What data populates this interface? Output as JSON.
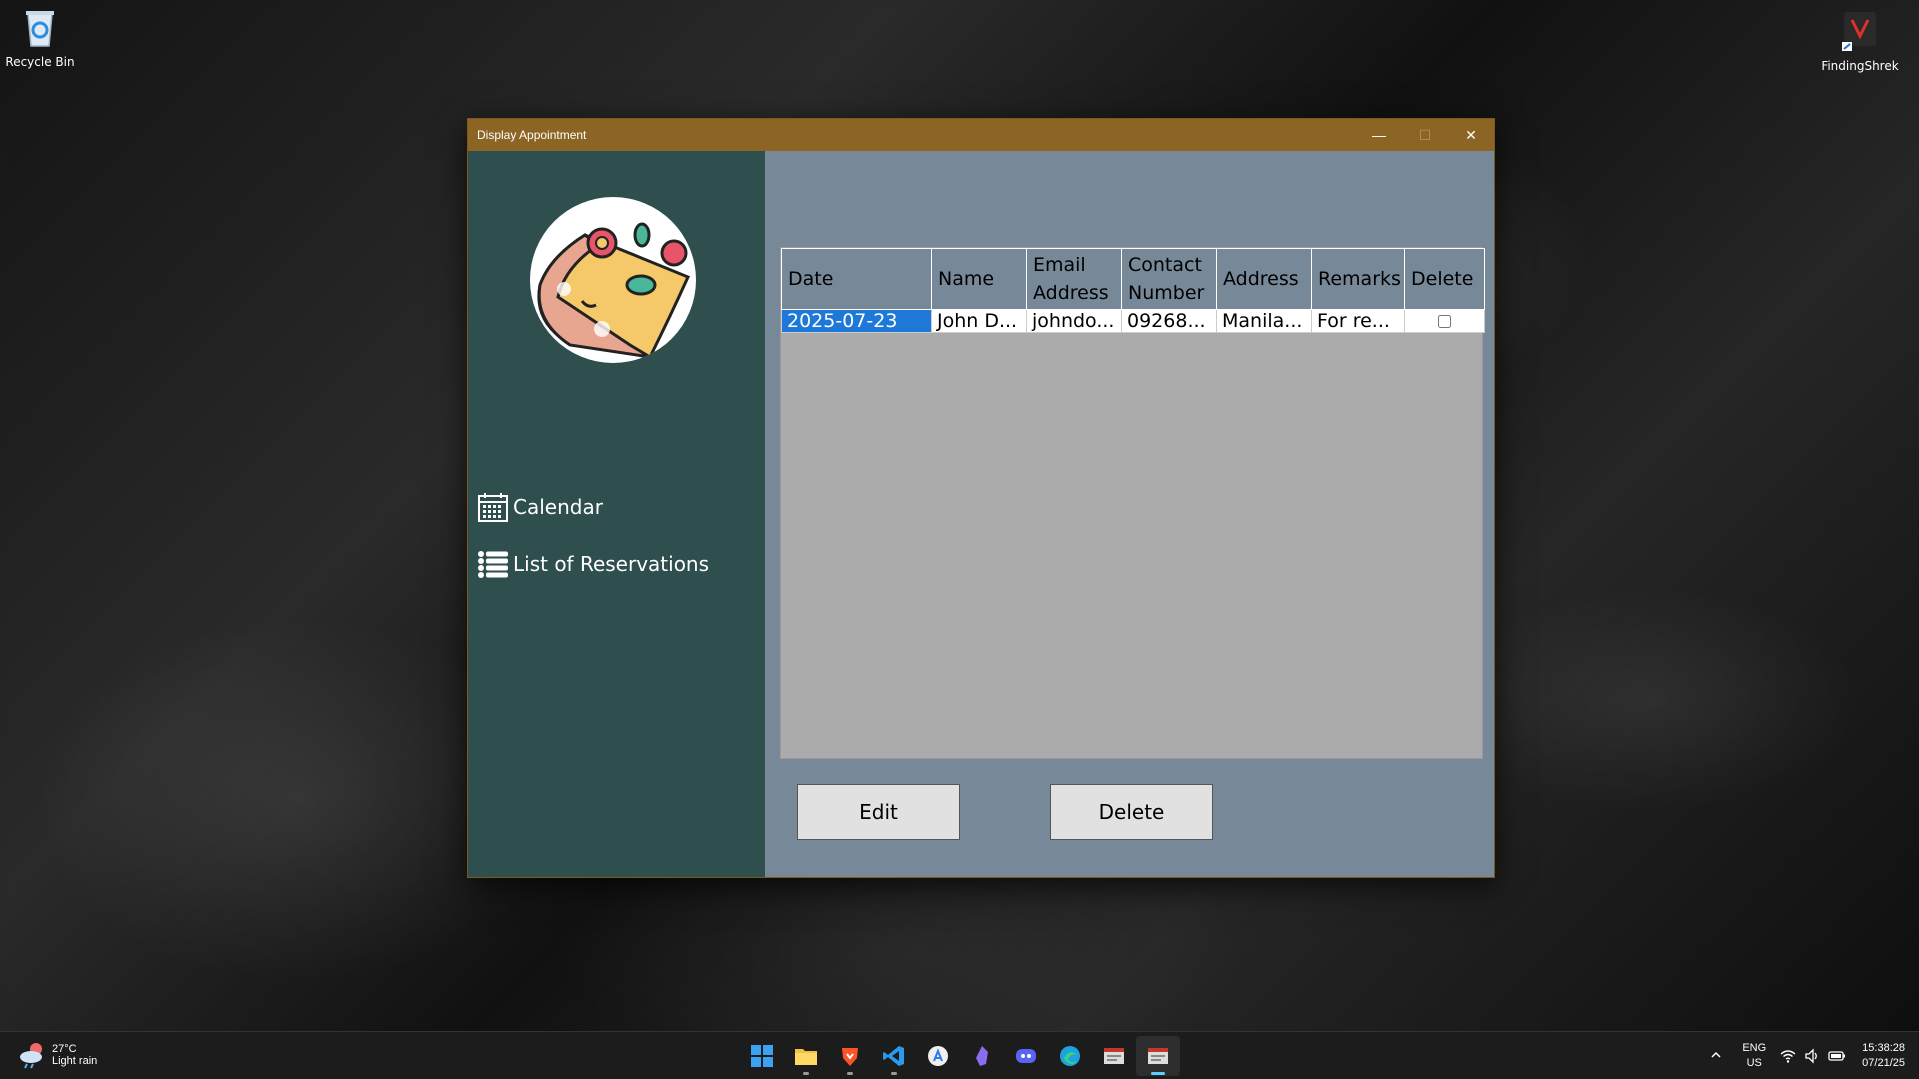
{
  "desktop": {
    "icons": [
      {
        "label": "Recycle Bin"
      },
      {
        "label": "FindingShrek"
      }
    ]
  },
  "window": {
    "title": "Display Appointment",
    "controls": {
      "minimize": "—",
      "maximize": "☐",
      "close": "✕"
    },
    "sidebar": {
      "nav": [
        {
          "label": "Calendar",
          "icon": "calendar-icon"
        },
        {
          "label": "List of Reservations",
          "icon": "list-icon"
        }
      ]
    },
    "grid": {
      "columns": [
        "Date",
        "Name",
        "Email Address",
        "Contact Number",
        "Address",
        "Remarks",
        "Delete"
      ],
      "rows": [
        {
          "date": "2025-07-23",
          "name": "John D...",
          "email": "johndo...",
          "contact": "09268...",
          "address": "Manila...",
          "remarks": "For re...",
          "delete": false
        }
      ]
    },
    "buttons": {
      "edit": "Edit",
      "delete": "Delete"
    }
  },
  "taskbar": {
    "weather": {
      "temp": "27°C",
      "desc": "Light rain"
    },
    "lang": {
      "line1": "ENG",
      "line2": "US"
    },
    "clock": {
      "time": "15:38:28",
      "date": "07/21/25"
    }
  },
  "colors": {
    "titlebar": "#8c6424",
    "sidebar": "#2f4f4f",
    "content": "#778899",
    "selection": "#1e78d7"
  }
}
